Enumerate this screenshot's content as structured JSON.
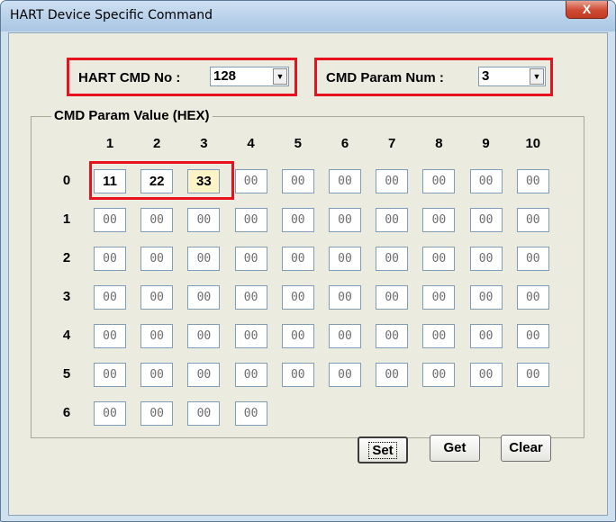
{
  "window": {
    "title": "HART Device Specific Command",
    "close_label": "X"
  },
  "cmd_no": {
    "label": "HART CMD No :",
    "value": "128"
  },
  "param_num": {
    "label": "CMD Param Num :",
    "value": "3"
  },
  "param_group": {
    "title": "CMD Param Value (HEX)",
    "columns": [
      "1",
      "2",
      "3",
      "4",
      "5",
      "6",
      "7",
      "8",
      "9",
      "10"
    ],
    "rows": [
      {
        "label": "0",
        "values": [
          "11",
          "22",
          "33",
          "00",
          "00",
          "00",
          "00",
          "00",
          "00",
          "00"
        ]
      },
      {
        "label": "1",
        "values": [
          "00",
          "00",
          "00",
          "00",
          "00",
          "00",
          "00",
          "00",
          "00",
          "00"
        ]
      },
      {
        "label": "2",
        "values": [
          "00",
          "00",
          "00",
          "00",
          "00",
          "00",
          "00",
          "00",
          "00",
          "00"
        ]
      },
      {
        "label": "3",
        "values": [
          "00",
          "00",
          "00",
          "00",
          "00",
          "00",
          "00",
          "00",
          "00",
          "00"
        ]
      },
      {
        "label": "4",
        "values": [
          "00",
          "00",
          "00",
          "00",
          "00",
          "00",
          "00",
          "00",
          "00",
          "00"
        ]
      },
      {
        "label": "5",
        "values": [
          "00",
          "00",
          "00",
          "00",
          "00",
          "00",
          "00",
          "00",
          "00",
          "00"
        ]
      },
      {
        "label": "6",
        "values": [
          "00",
          "00",
          "00",
          "00"
        ]
      }
    ]
  },
  "buttons": {
    "set": "Set",
    "get": "Get",
    "clear": "Clear"
  },
  "colors": {
    "highlight_box": "#e8121f",
    "focused_cell": "#fcf3c6"
  }
}
